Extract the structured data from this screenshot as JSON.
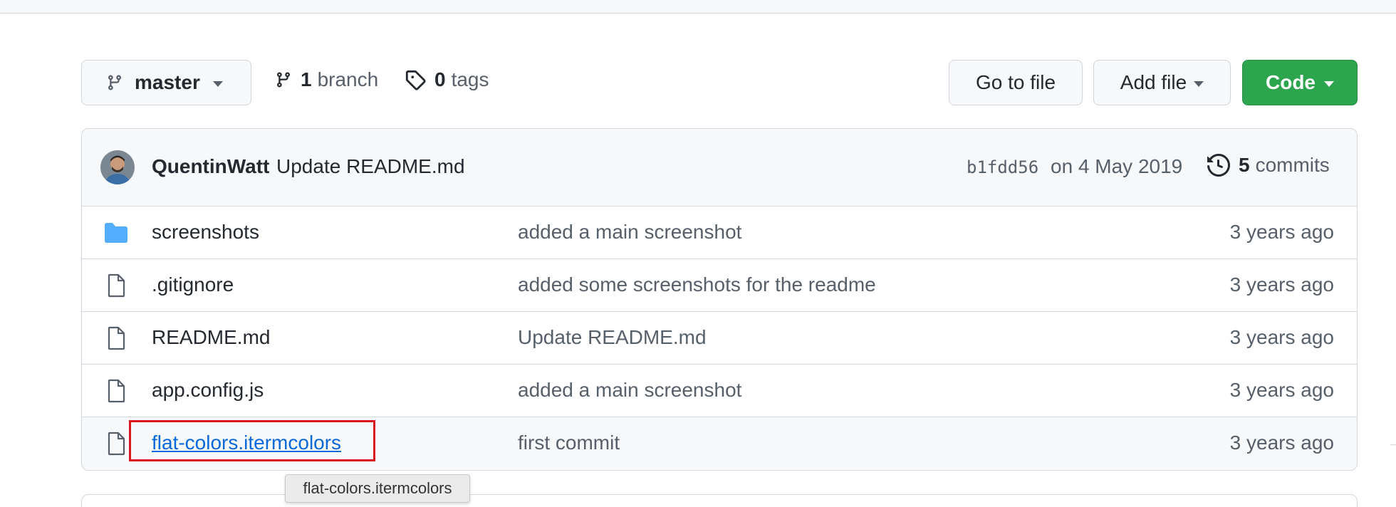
{
  "toolbar": {
    "branch_name": "master",
    "branch_count": "1",
    "branch_word": "branch",
    "tag_count": "0",
    "tag_word": "tags",
    "go_to_file": "Go to file",
    "add_file": "Add file",
    "code": "Code"
  },
  "latest_commit": {
    "author": "QuentinWatt",
    "message": "Update README.md",
    "sha": "b1fdd56",
    "date": "on 4 May 2019",
    "commit_count": "5",
    "commit_word": "commits"
  },
  "files": [
    {
      "name": "screenshots",
      "type": "folder",
      "commit_message": "added a main screenshot",
      "age": "3 years ago"
    },
    {
      "name": ".gitignore",
      "type": "file",
      "commit_message": "added some screenshots for the readme",
      "age": "3 years ago"
    },
    {
      "name": "README.md",
      "type": "file",
      "commit_message": "Update README.md",
      "age": "3 years ago"
    },
    {
      "name": "app.config.js",
      "type": "file",
      "commit_message": "added a main screenshot",
      "age": "3 years ago"
    },
    {
      "name": "flat-colors.itermcolors",
      "type": "file",
      "commit_message": "first commit",
      "age": "3 years ago"
    }
  ],
  "tooltip": {
    "text": "flat-colors.itermcolors"
  },
  "colors": {
    "primary_button": "#2da44e",
    "link": "#0969da",
    "folder_icon": "#54aeff",
    "highlight": "#d7191e"
  },
  "icons": {
    "branch": "git-branch-icon",
    "tag": "tag-icon",
    "history": "history-icon",
    "folder": "folder-icon",
    "file": "file-icon"
  }
}
